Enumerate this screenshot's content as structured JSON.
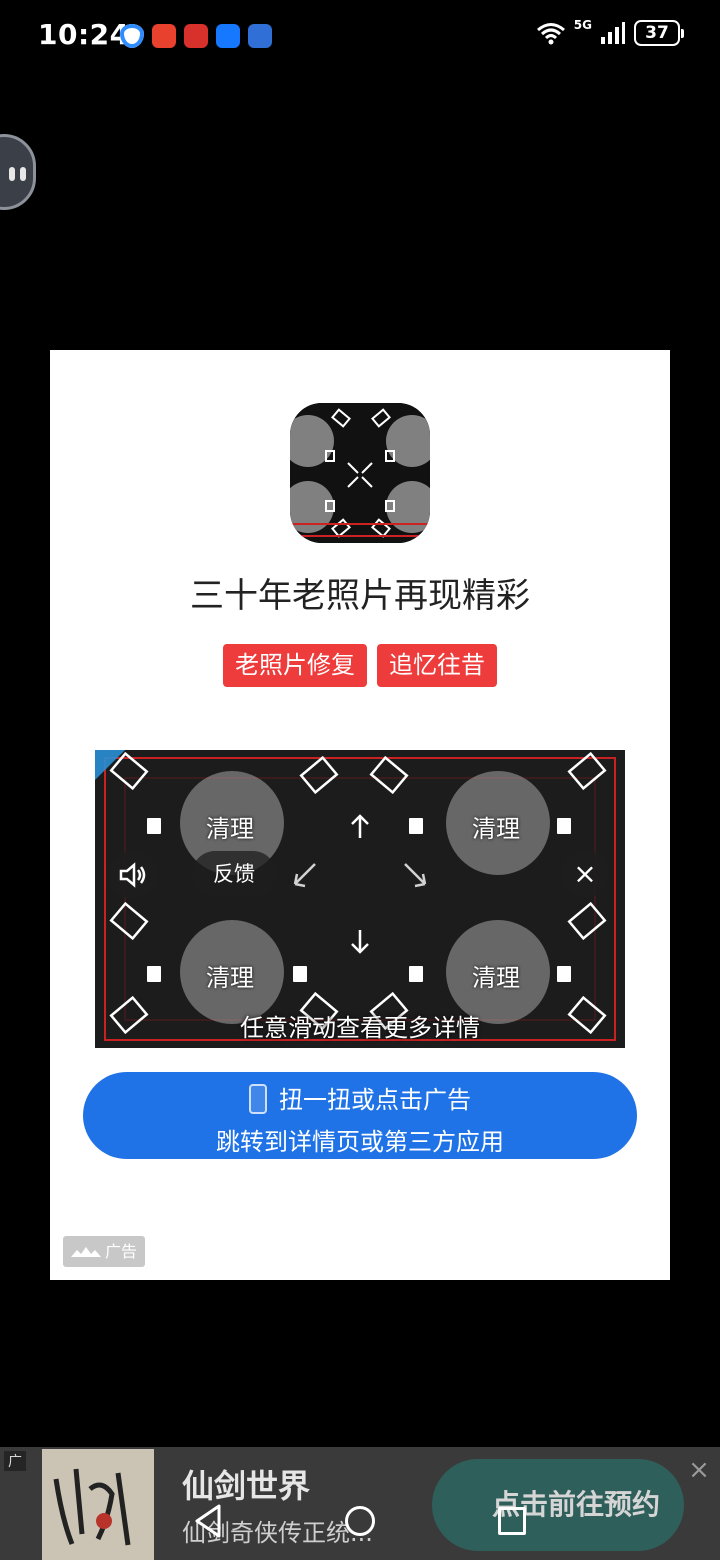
{
  "status_bar": {
    "time": "10:24",
    "network": "5G",
    "battery": "37",
    "app_icons": [
      "shield-icon",
      "red-app-icon",
      "red-app-icon",
      "alipay-icon",
      "blue-app-icon"
    ]
  },
  "dialog": {
    "title": "三十年老照片再现精彩",
    "tags": [
      "老照片修复",
      "追忆往昔"
    ],
    "media": {
      "clean_labels": [
        "清理",
        "清理",
        "清理",
        "清理"
      ],
      "feedback_label": "反馈",
      "close_glyph": "×",
      "swipe_hint": "任意滑动查看更多详情"
    },
    "cta": {
      "line1": "扭一扭或点击广告",
      "line2": "跳转到详情页或第三方应用"
    },
    "ad_label": "广告"
  },
  "banner": {
    "ad_tag": "广",
    "title": "仙剑世界",
    "subtitle": "仙剑奇侠传正统...",
    "button": "点击前往预约",
    "close_glyph": "×"
  },
  "colors": {
    "tag_red": "#ee3b3b",
    "cta_blue": "#1f73e6"
  }
}
